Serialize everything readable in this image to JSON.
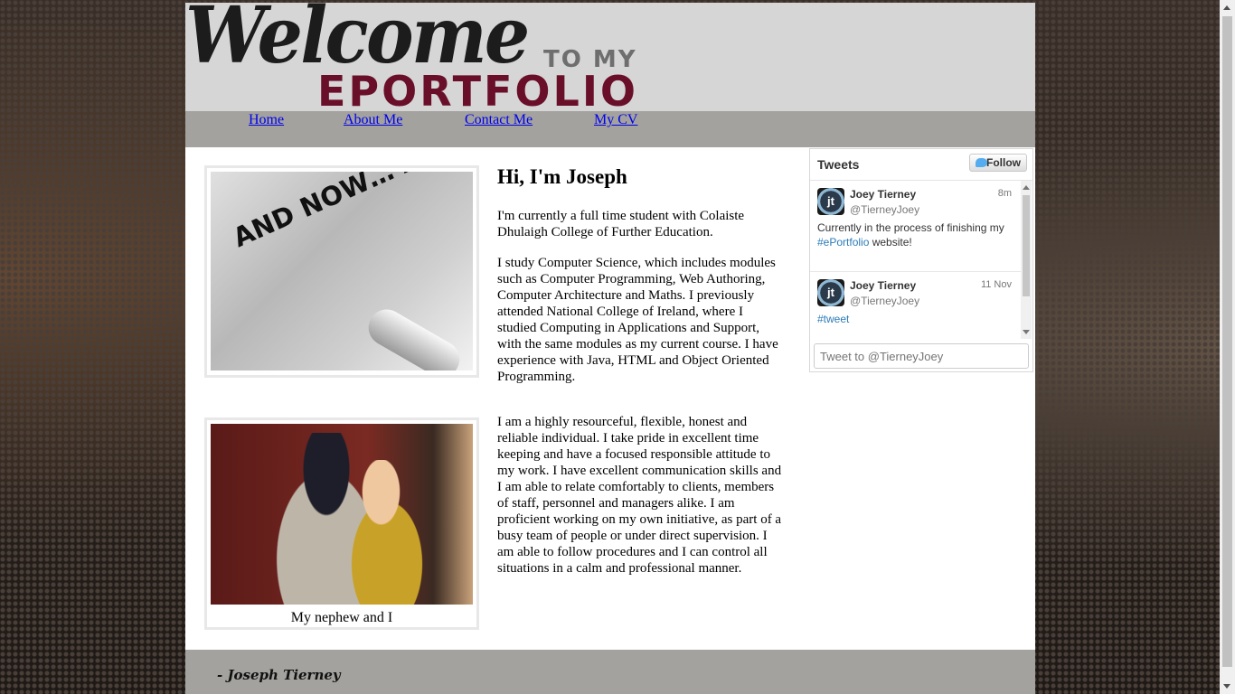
{
  "header": {
    "logo_welcome": "Welcome",
    "logo_to_my": "TO MY",
    "logo_eportfolio": "EPORTFOLIO"
  },
  "nav": {
    "items": [
      {
        "label": "Home"
      },
      {
        "label": "About Me"
      },
      {
        "label": "Contact Me"
      },
      {
        "label": "My CV"
      }
    ]
  },
  "main": {
    "image1_text": "AND NOW… A LITTLE ABOUT ME",
    "heading": "Hi, I'm Joseph",
    "paragraphs": [
      "I'm currently a full time student with Colaiste Dhulaigh College of Further Education.",
      "I study Computer Science, which includes modules such as Computer Programming, Web Authoring, Computer Architecture and Maths. I previously attended National College of Ireland, where I studied Computing in Applications and Support, with the same modules as my current course. I have experience with Java, HTML and Object Oriented Programming.",
      "I am a highly resourceful, flexible, honest and reliable individual. I take pride in excellent time keeping and have a focused responsible attitude to my work. I have excellent communication skills and I am able to relate comfortably to clients, members of staff, personnel and managers alike. I am proficient working on my own initiative, as part of a busy team of people or under direct supervision. I am able to follow procedures and I can control all situations in a calm and professional manner."
    ],
    "image2_caption": "My nephew and I"
  },
  "twitter": {
    "title": "Tweets",
    "follow_label": "Follow",
    "tweets": [
      {
        "name": "Joey Tierney",
        "handle": "@TierneyJoey",
        "time": "8m",
        "text": "Currently in the process of finishing my ",
        "link": "#ePortfolio",
        "text_after": " website!"
      },
      {
        "name": "Joey Tierney",
        "handle": "@TierneyJoey",
        "time": "11 Nov",
        "text": "",
        "link": "#tweet",
        "text_after": ""
      }
    ],
    "input_placeholder": "Tweet to @TierneyJoey",
    "avatar_letter": "jt"
  },
  "footer": {
    "signature": "- Joseph Tierney"
  }
}
